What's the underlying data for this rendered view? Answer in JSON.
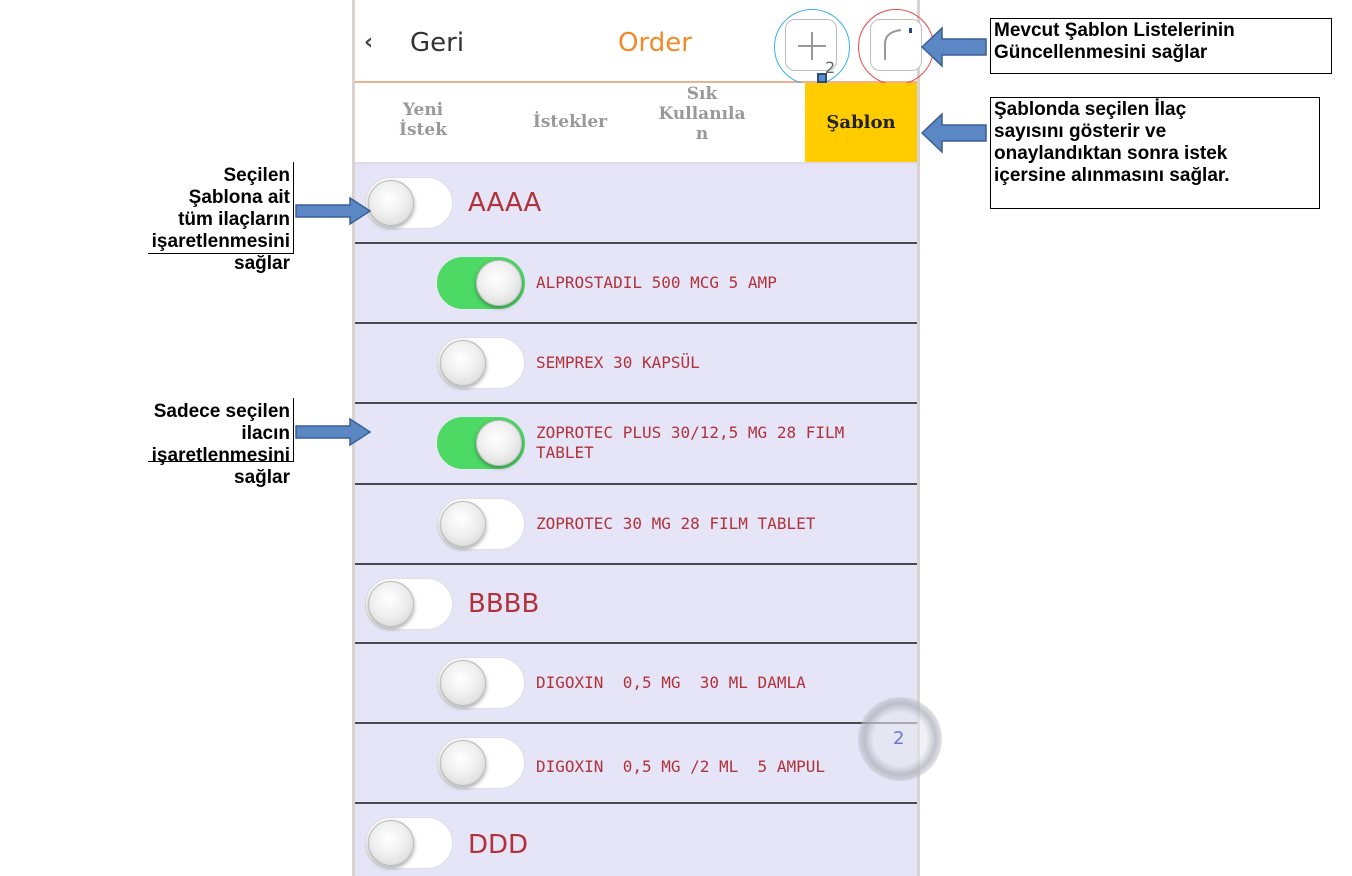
{
  "header": {
    "back_label": "Geri",
    "title": "Order",
    "add_count": "2"
  },
  "tabs": [
    {
      "label_line1": "Yeni",
      "label_line2": "İstek"
    },
    {
      "label": "İstekler"
    },
    {
      "label_line1": "Sık",
      "label_line2": "Kullanıla",
      "label_line3": "n"
    },
    {
      "label": "Şablon",
      "active": true
    }
  ],
  "list": {
    "groups": [
      {
        "name": "AAAA",
        "on": false,
        "items": [
          {
            "name": "ALPROSTADIL 500 MCG 5 AMP",
            "on": true
          },
          {
            "name": "SEMPREX 30 KAPSÜL",
            "on": false
          },
          {
            "name_line1": "ZOPROTEC PLUS 30/12,5 MG 28 FILM",
            "name_line2": "TABLET",
            "on": true
          },
          {
            "name": "ZOPROTEC 30 MG 28 FILM TABLET",
            "on": false
          }
        ]
      },
      {
        "name": "BBBB",
        "on": false,
        "items": [
          {
            "name": "DIGOXIN  0,5 MG  30 ML DAMLA",
            "on": false
          },
          {
            "name": "DIGOXIN  0,5 MG /2 ML  5 AMPUL",
            "on": false
          }
        ]
      },
      {
        "name": "DDD",
        "on": false,
        "items": []
      }
    ]
  },
  "badge": {
    "count": "2"
  },
  "annotations": {
    "update_lists": {
      "line1": "Mevcut Şablon Listelerinin",
      "line2": "Güncellenmesini sağlar"
    },
    "selected_count": {
      "line1": "Şablonda seçilen İlaç",
      "line2": "sayısını gösterir ve",
      "line3": "onaylandıktan sonra istek",
      "line4": "içersine alınmasını sağlar."
    },
    "select_all": {
      "line1": "Seçilen Şablona ait",
      "line2": "tüm ilaçların",
      "line3": "işaretlenmesini sağlar"
    },
    "select_one": {
      "line1": "Sadece seçilen ilacın",
      "line2": "işaretlenmesini sağlar"
    }
  },
  "colors": {
    "accent_orange": "#f08a2a",
    "tab_active": "#ffcc00",
    "toggle_on": "#4cd964",
    "list_bg": "#e5e5f7",
    "item_text": "#b0323a",
    "arrow": "#5b87c5"
  }
}
